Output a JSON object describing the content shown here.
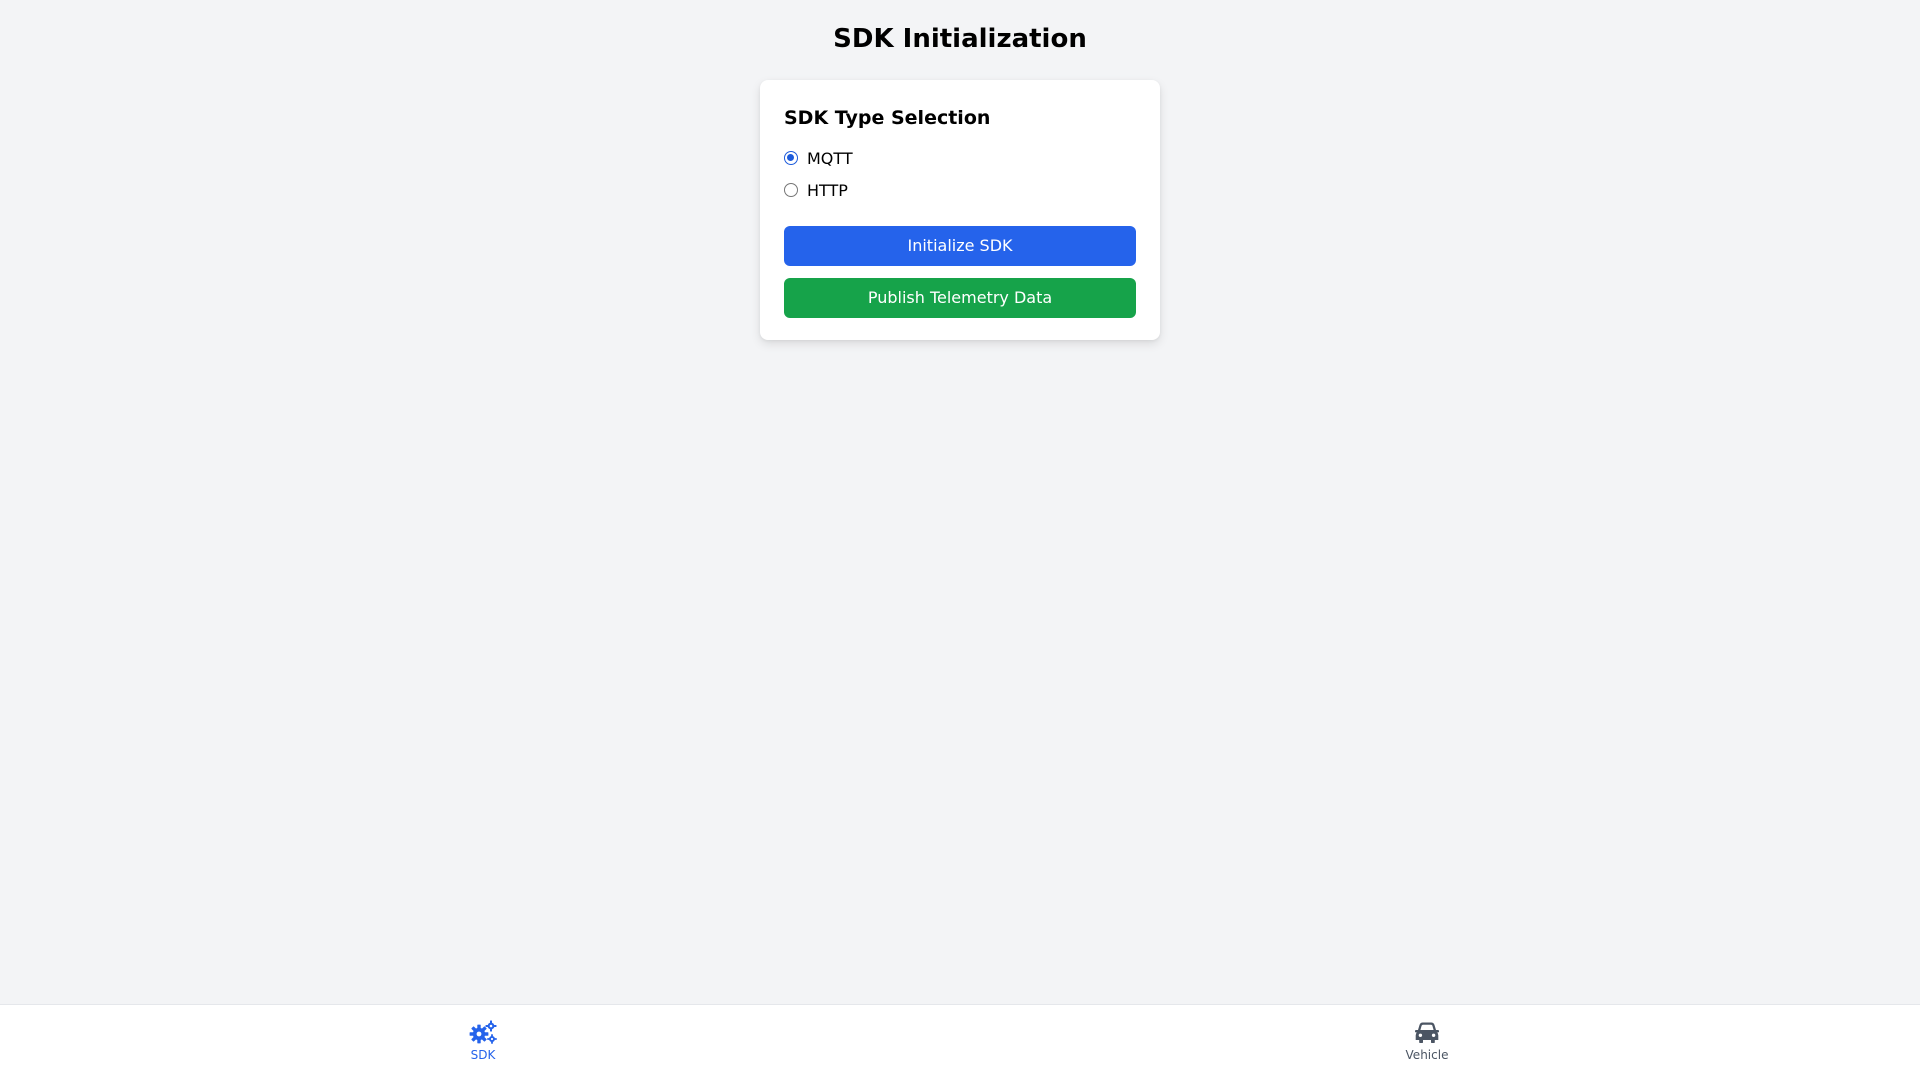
{
  "page": {
    "title": "SDK Initialization"
  },
  "card": {
    "title": "SDK Type Selection",
    "options": [
      {
        "label": "MQTT",
        "checked": true
      },
      {
        "label": "HTTP",
        "checked": false
      }
    ],
    "initialize_button": "Initialize SDK",
    "publish_button": "Publish Telemetry Data"
  },
  "bottom_nav": {
    "items": [
      {
        "label": "SDK",
        "icon": "gears-icon",
        "active": true
      },
      {
        "label": "Vehicle",
        "icon": "car-icon",
        "active": false
      }
    ]
  },
  "colors": {
    "background": "#f3f4f6",
    "primary": "#2563eb",
    "success": "#16a34a",
    "nav_active": "#2563eb",
    "nav_inactive": "#4b5563"
  }
}
